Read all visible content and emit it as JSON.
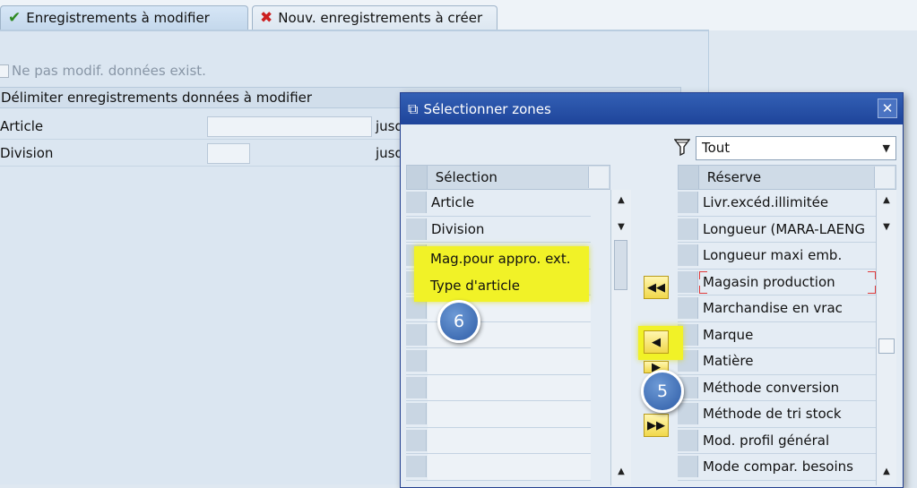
{
  "tabs": [
    {
      "label": "Enregistrements à modifier",
      "icon": "checkmark-icon",
      "active": true
    },
    {
      "label": "Nouv. enregistrements à créer",
      "icon": "red-x-icon",
      "active": false
    }
  ],
  "options": {
    "no_modify_label": "Ne pas modif. données exist."
  },
  "delimit": {
    "header": "Délimiter enregistrements données à modifier",
    "fields": [
      {
        "label": "Article",
        "value": "",
        "to_label": "jusq"
      },
      {
        "label": "Division",
        "value": "",
        "to_label": "jusq"
      }
    ]
  },
  "dialog": {
    "title": "Sélectionner zones",
    "filter_value": "Tout",
    "selection_header": "Sélection",
    "reserve_header": "Réserve",
    "selection_items": [
      "Article",
      "Division",
      "Mag.pour appro. ext.",
      "Type d'article"
    ],
    "reserve_items": [
      "Livr.excéd.illimitée",
      "Longueur (MARA-LAENG",
      "Longueur maxi emb.",
      "Magasin production",
      "Marchandise en vrac",
      "Marque",
      "Matière",
      "Méthode conversion",
      "Méthode de tri stock",
      "Mod. profil général",
      "Mode compar. besoins"
    ]
  },
  "annotations": {
    "badge_6": "6",
    "badge_5": "5"
  },
  "colors": {
    "highlight": "#f1f227",
    "badge": "#3e6bb3",
    "titlebar": "#2a52a8"
  }
}
